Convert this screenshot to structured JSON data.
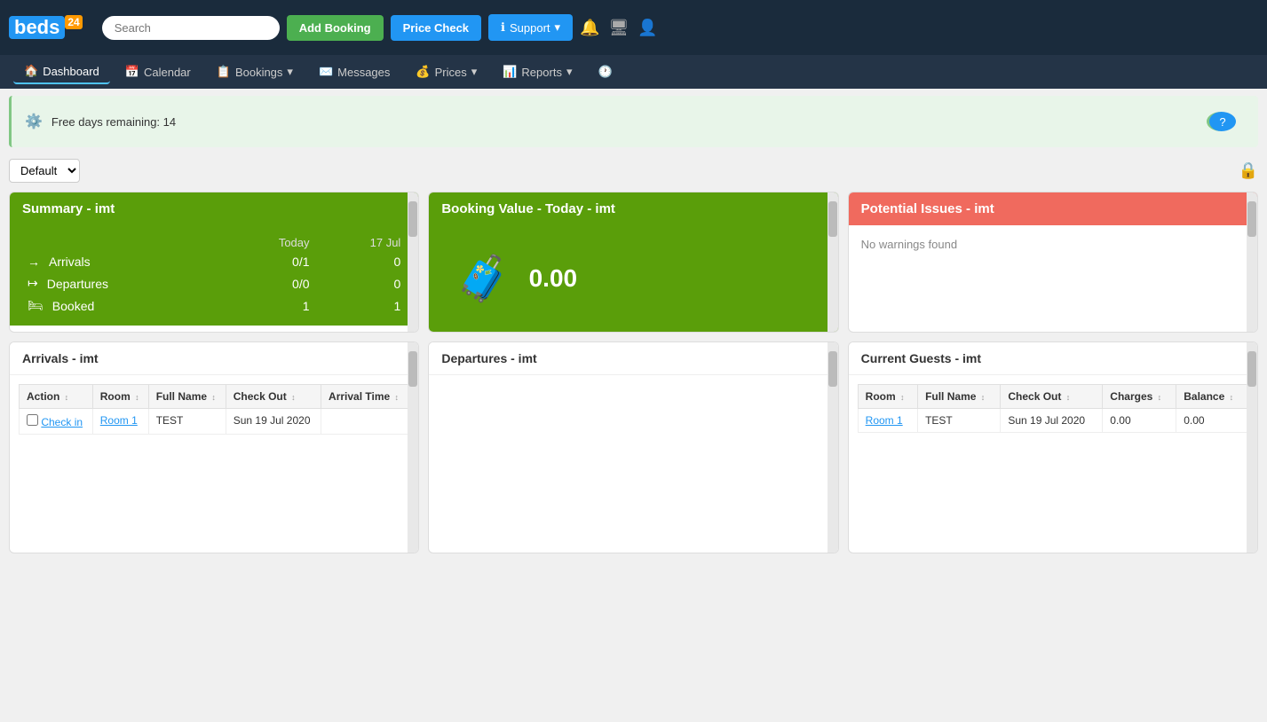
{
  "logo": {
    "text": "beds",
    "badge": "24"
  },
  "topNav": {
    "search_placeholder": "Search",
    "add_booking_label": "Add Booking",
    "price_check_label": "Price Check",
    "support_label": "Support"
  },
  "secondNav": {
    "links": [
      {
        "label": "Dashboard",
        "icon": "🏠",
        "active": true
      },
      {
        "label": "Calendar",
        "icon": "📅",
        "active": false
      },
      {
        "label": "Bookings",
        "icon": "📋",
        "active": false,
        "dropdown": true
      },
      {
        "label": "Messages",
        "icon": "✉️",
        "active": false
      },
      {
        "label": "Prices",
        "icon": "💰",
        "active": false,
        "dropdown": true
      },
      {
        "label": "Reports",
        "icon": "📊",
        "active": false,
        "dropdown": true
      },
      {
        "label": "",
        "icon": "🕐",
        "active": false
      }
    ]
  },
  "trialBanner": {
    "text": "Free days remaining: 14"
  },
  "toolbar": {
    "select_default": "Default",
    "select_options": [
      "Default"
    ]
  },
  "summaryWidget": {
    "title": "Summary - imt",
    "header_today": "Today",
    "header_date": "17 Jul",
    "rows": [
      {
        "icon": "→",
        "label": "Arrivals",
        "today": "0/1",
        "date": "0"
      },
      {
        "icon": "↦",
        "label": "Departures",
        "today": "0/0",
        "date": "0"
      },
      {
        "icon": "🛏",
        "label": "Booked",
        "today": "1",
        "date": "1"
      }
    ]
  },
  "bookingValueWidget": {
    "title": "Booking Value - Today - imt",
    "amount": "0.00"
  },
  "potentialIssuesWidget": {
    "title": "Potential Issues - imt",
    "message": "No warnings found"
  },
  "arrivalsWidget": {
    "title": "Arrivals - imt",
    "columns": [
      "Action",
      "Room",
      "Full Name",
      "Check Out",
      "Arrival Time"
    ],
    "rows": [
      {
        "action": "Check in",
        "room": "Room 1",
        "full_name": "TEST",
        "check_out": "Sun 19 Jul 2020",
        "arrival_time": ""
      }
    ]
  },
  "departuresWidget": {
    "title": "Departures - imt",
    "columns": [],
    "rows": []
  },
  "currentGuestsWidget": {
    "title": "Current Guests - imt",
    "columns": [
      "Room",
      "Full Name",
      "Check Out",
      "Charges",
      "Balance"
    ],
    "rows": [
      {
        "room": "Room 1",
        "full_name": "TEST",
        "check_out": "Sun 19 Jul 2020",
        "charges": "0.00",
        "balance": "0.00"
      }
    ]
  }
}
